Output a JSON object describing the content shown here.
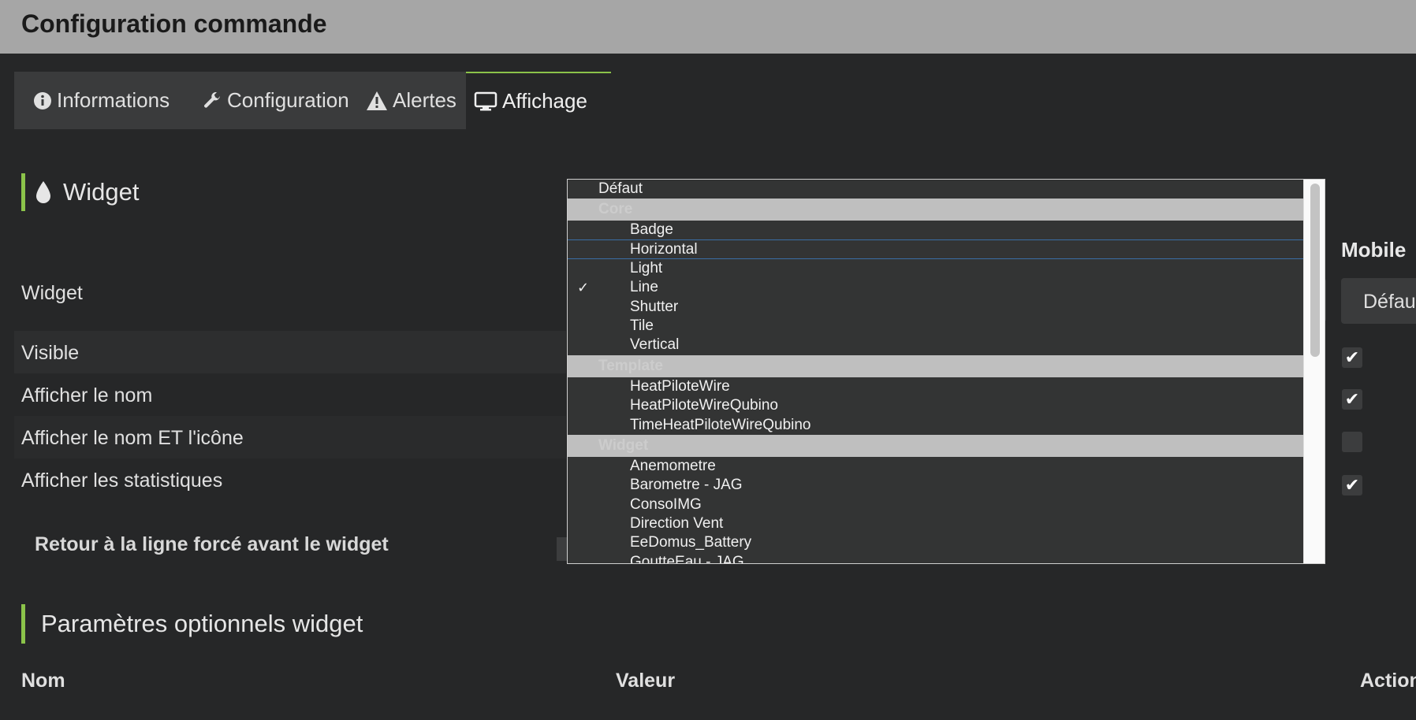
{
  "header": {
    "title": "Configuration commande"
  },
  "tabs": [
    {
      "label": "Informations",
      "icon": "info-circle-icon"
    },
    {
      "label": "Configuration",
      "icon": "wrench-icon"
    },
    {
      "label": "Alertes",
      "icon": "warning-icon"
    },
    {
      "label": "Affichage",
      "icon": "desktop-icon",
      "active": true
    }
  ],
  "widget_section": {
    "title": "Widget",
    "icon": "droplet-icon"
  },
  "rows": {
    "widget": "Widget",
    "visible": "Visible",
    "afficher_nom": "Afficher le nom",
    "afficher_nom_icone": "Afficher le nom ET l'icône",
    "afficher_stats": "Afficher les statistiques"
  },
  "mobile": {
    "header": "Mobile",
    "select_value": "Défau",
    "visible": true,
    "afficher_nom": true,
    "afficher_nom_icone": false,
    "afficher_stats": true
  },
  "retour_label": "Retour à la ligne forcé avant le widget",
  "optional_section": {
    "title": "Paramètres optionnels widget"
  },
  "table_headers": {
    "nom": "Nom",
    "valeur": "Valeur",
    "action": "Action"
  },
  "dropdown": {
    "default": "Défaut",
    "groups": [
      {
        "label": "Core",
        "items": [
          "Badge",
          "Horizontal",
          "Light",
          "Line",
          "Shutter",
          "Tile",
          "Vertical"
        ]
      },
      {
        "label": "Template",
        "items": [
          "HeatPiloteWire",
          "HeatPiloteWireQubino",
          "TimeHeatPiloteWireQubino"
        ]
      },
      {
        "label": "Widget",
        "items": [
          "Anemometre",
          "Barometre - JAG",
          "ConsoIMG",
          "Direction Vent",
          "EeDomus_Battery",
          "GoutteEau - JAG"
        ]
      }
    ],
    "checked_item": "Line",
    "check_glyph": "✓",
    "highlighted_items": [
      "Horizontal",
      "Light"
    ]
  }
}
